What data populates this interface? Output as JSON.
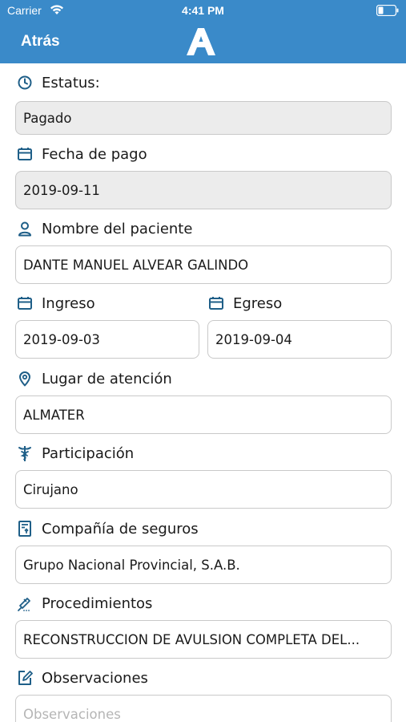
{
  "status_bar": {
    "carrier": "Carrier",
    "time": "4:41 PM"
  },
  "nav": {
    "back_label": "Atrás",
    "logo_icon": "a-logo-icon"
  },
  "form": {
    "status": {
      "label": "Estatus:",
      "value": "Pagado",
      "icon": "clock-icon"
    },
    "payment_date": {
      "label": "Fecha de pago",
      "value": "2019-09-11",
      "icon": "calendar-icon"
    },
    "patient_name": {
      "label": "Nombre del paciente",
      "value": "DANTE MANUEL ALVEAR GALINDO",
      "icon": "user-icon"
    },
    "admission": {
      "label": "Ingreso",
      "value": "2019-09-03",
      "icon": "calendar-icon"
    },
    "discharge": {
      "label": "Egreso",
      "value": "2019-09-04",
      "icon": "calendar-icon"
    },
    "place": {
      "label": "Lugar de atención",
      "value": "ALMATER",
      "icon": "location-pin-icon"
    },
    "participation": {
      "label": "Participación",
      "value": "Cirujano",
      "icon": "caduceus-icon"
    },
    "insurer": {
      "label": "Compañía de seguros",
      "value": "Grupo Nacional Provincial, S.A.B.",
      "icon": "document-icon"
    },
    "procedures": {
      "label": "Procedimientos",
      "value": "RECONSTRUCCION DE AVULSION COMPLETA DEL...",
      "icon": "procedure-icon"
    },
    "observations": {
      "label": "Observaciones",
      "placeholder": "Observaciones",
      "icon": "edit-icon"
    }
  },
  "colors": {
    "primary": "#3a8ac9",
    "icon": "#1f5f88",
    "readonly_bg": "#ececec",
    "border": "#c9c9c9"
  }
}
